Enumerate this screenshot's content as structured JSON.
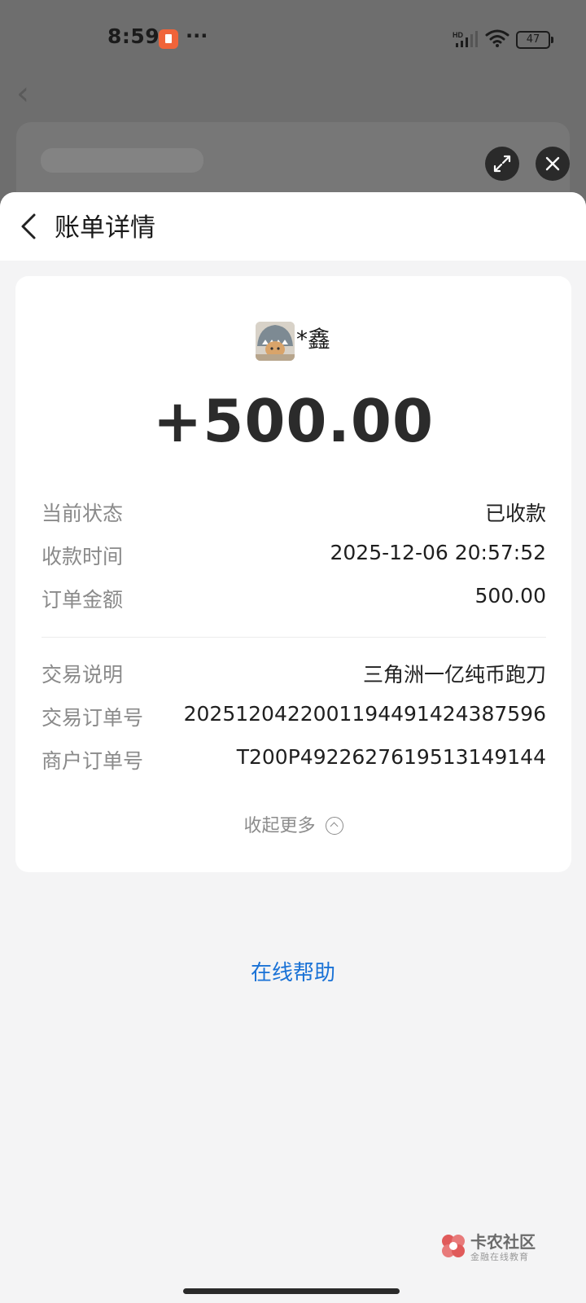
{
  "status_bar": {
    "time": "8:59",
    "dots": "···",
    "network_label": "HD",
    "battery": "47",
    "icons": [
      "app-notification-icon",
      "signal-icon",
      "wifi-icon",
      "battery-icon"
    ]
  },
  "overlay": {
    "buttons": [
      "expand-icon",
      "close-icon"
    ]
  },
  "header": {
    "title": "账单详情"
  },
  "payee": {
    "name": "*鑫",
    "avatar_icon": "shark-hat-cat-avatar"
  },
  "amount": "+500.00",
  "details": [
    {
      "label": "当前状态",
      "value": "已收款"
    },
    {
      "label": "收款时间",
      "value": "2025-12-06 20:57:52"
    },
    {
      "label": "订单金额",
      "value": "500.00"
    }
  ],
  "details2": [
    {
      "label": "交易说明",
      "value": "三角洲一亿纯币跑刀"
    },
    {
      "label": "交易订单号",
      "value": "2025120422001194491424387596"
    },
    {
      "label": "商户订单号",
      "value": "T200P4922627619513149144"
    }
  ],
  "collapse_label": "收起更多",
  "help_label": "在线帮助",
  "watermark": {
    "title": "卡农社区",
    "subtitle": "金融在线教育"
  },
  "colors": {
    "link": "#1a72d6",
    "label_gray": "#8a8a8a",
    "amount": "#2b2b2b",
    "watermark_red": "#e05a5a"
  }
}
